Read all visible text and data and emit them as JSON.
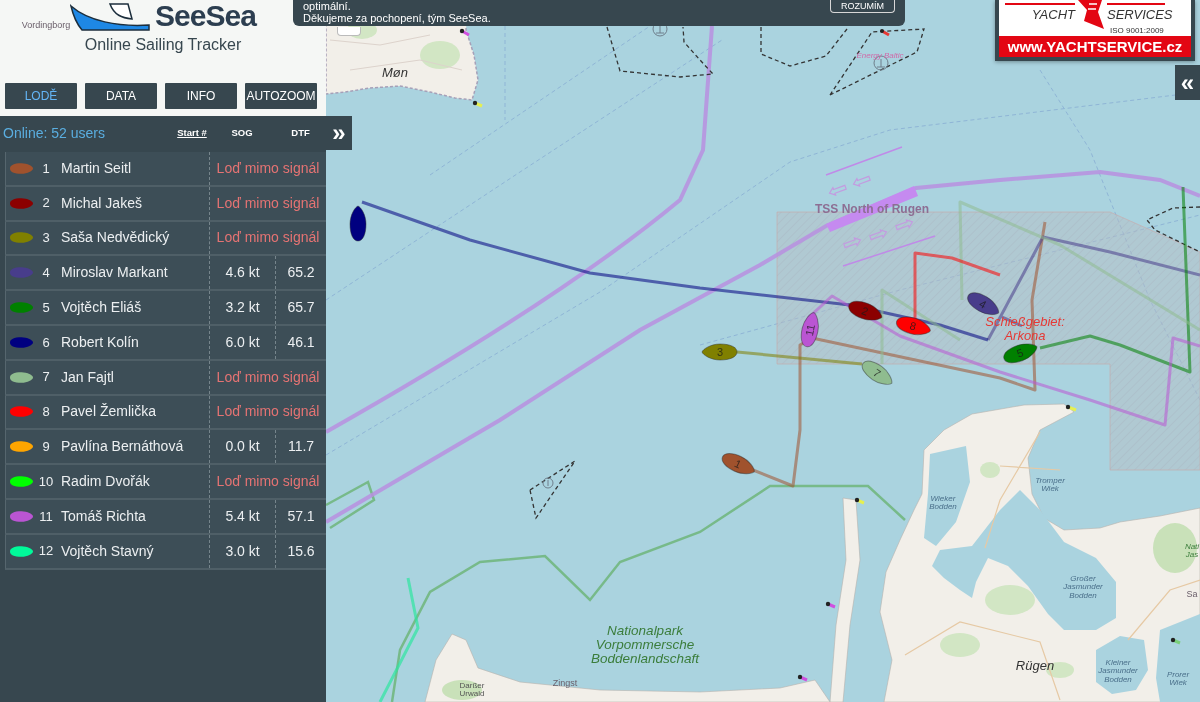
{
  "notice": {
    "lines": [
      "optimální.",
      "Děkujeme za pochopení, tým SeeSea."
    ],
    "button": "ROZUMÍM"
  },
  "brand": {
    "name": "SeeSea",
    "tagline": "Online Sailing Tracker"
  },
  "nav_buttons": [
    {
      "label": "LODĚ",
      "selected": true
    },
    {
      "label": "DATA",
      "selected": false
    },
    {
      "label": "INFO",
      "selected": false
    },
    {
      "label": "AUTOZOOM",
      "selected": false
    }
  ],
  "list_header": {
    "online": "Online: 52 users",
    "columns": [
      "Start #",
      "SOG",
      "DTF"
    ],
    "toggle": "»"
  },
  "boats": [
    {
      "number": "1",
      "name": "Martin Seitl",
      "color": "#a0522d",
      "kind": "offline",
      "status": "Loď mimo signál"
    },
    {
      "number": "2",
      "name": "Michal Jakeš",
      "color": "#8b0000",
      "kind": "offline",
      "status": "Loď mimo signál"
    },
    {
      "number": "3",
      "name": "Saša Nedvědický",
      "color": "#808000",
      "kind": "offline",
      "status": "Loď mimo signál"
    },
    {
      "number": "4",
      "name": "Miroslav Markant",
      "color": "#483d8b",
      "kind": "live",
      "sog": "4.6 kt",
      "dtf": "65.2"
    },
    {
      "number": "5",
      "name": "Vojtěch Eliáš",
      "color": "#008000",
      "kind": "live",
      "sog": "3.2 kt",
      "dtf": "65.7"
    },
    {
      "number": "6",
      "name": "Robert Kolín",
      "color": "#000080",
      "kind": "live",
      "sog": "6.0 kt",
      "dtf": "46.1"
    },
    {
      "number": "7",
      "name": "Jan Fajtl",
      "color": "#8fbc8f",
      "kind": "offline",
      "status": "Loď mimo signál"
    },
    {
      "number": "8",
      "name": "Pavel Žemlička",
      "color": "#ff0000",
      "kind": "offline",
      "status": "Loď mimo signál"
    },
    {
      "number": "9",
      "name": "Pavlína Bernáthová",
      "color": "#ffa500",
      "kind": "live",
      "sog": "0.0 kt",
      "dtf": "11.7"
    },
    {
      "number": "10",
      "name": "Radim Dvořák",
      "color": "#00ff00",
      "kind": "offline",
      "status": "Loď mimo signál"
    },
    {
      "number": "11",
      "name": "Tomáš Richta",
      "color": "#ba55d3",
      "kind": "live",
      "sog": "5.4 kt",
      "dtf": "57.1"
    },
    {
      "number": "12",
      "name": "Vojtěch Stavný",
      "color": "#00fa9a",
      "kind": "live",
      "sog": "3.0 kt",
      "dtf": "15.6"
    }
  ],
  "sponsor": {
    "left": "YACHT",
    "right": "SERVICES",
    "certificate": "ISO 9001:2009",
    "url": "www.YACHTSERVICE.cz"
  },
  "map": {
    "toggle": "«",
    "labels": [
      {
        "text": "Vordingborg",
        "kind": "town"
      },
      {
        "text": "Møn",
        "kind": "island"
      },
      {
        "text": "Energy Baltic",
        "kind": "windfarm"
      },
      {
        "text": "TSS North of Rugen",
        "kind": "zone"
      },
      {
        "text": "Schießgebiet: Arkona",
        "kind": "danger"
      },
      {
        "text": "Tromper Wiek",
        "kind": "water"
      },
      {
        "text": "Wieker Bodden",
        "kind": "water"
      },
      {
        "text": "Großer Jasmunder Bodden",
        "kind": "water"
      },
      {
        "text": "Sa",
        "kind": "town"
      },
      {
        "text": "Nationalpark Vorpommersche Boddenlandschaft",
        "kind": "park"
      },
      {
        "text": "Rügen",
        "kind": "island"
      },
      {
        "text": "Kleiner Jasmunder Bodden",
        "kind": "water"
      },
      {
        "text": "Prorer Wiek",
        "kind": "water"
      },
      {
        "text": "Darßer Urwald",
        "kind": "forest"
      },
      {
        "text": "Zingst",
        "kind": "town"
      },
      {
        "text": "Nati Jas",
        "kind": "parksmall"
      }
    ],
    "boats": [
      {
        "label": "1",
        "color": "#a0522d"
      },
      {
        "label": "2",
        "color": "#8b0000"
      },
      {
        "label": "3",
        "color": "#808000"
      },
      {
        "label": "4",
        "color": "#483d8b"
      },
      {
        "label": "5",
        "color": "#008000"
      },
      {
        "color": "#000080"
      },
      {
        "label": "7",
        "color": "#8fbc8f"
      },
      {
        "label": "8",
        "color": "#ff0000"
      },
      {
        "label": "11",
        "color": "#ba55d3"
      }
    ]
  }
}
